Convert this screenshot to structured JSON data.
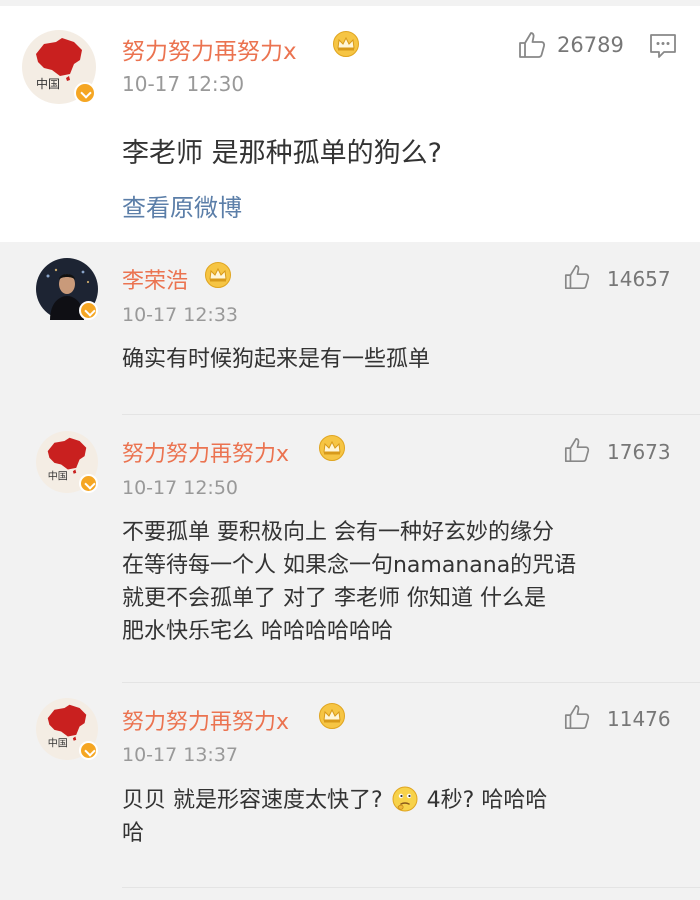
{
  "main_post": {
    "username": "努力努力再努力x",
    "time": "10-17 12:30",
    "likes": "26789",
    "text": "李老师 是那种孤单的狗么?",
    "view_original": "查看原微博"
  },
  "replies": [
    {
      "username": "李荣浩",
      "time": "10-17 12:33",
      "likes": "14657",
      "text": "确实有时候狗起来是有一些孤单"
    },
    {
      "username": "努力努力再努力x",
      "time": "10-17 12:50",
      "likes": "17673",
      "text_lines": [
        "不要孤单 要积极向上 会有一种好玄妙的缘分",
        "在等待每一个人 如果念一句namanana的咒语",
        "就更不会孤单了 对了 李老师 你知道 什么是",
        "肥水快乐宅么 哈哈哈哈哈哈"
      ]
    },
    {
      "username": "努力努力再努力x",
      "time": "10-17 13:37",
      "likes": "11476",
      "text_part1": "贝贝 就是形容速度太快了?",
      "text_part2": "4秒? 哈哈哈",
      "text_line2": "哈"
    }
  ],
  "avatar_text": {
    "china": "中国"
  },
  "colors": {
    "username": "#eb7350",
    "link": "#5b7ea8",
    "badge": "#f5a623"
  },
  "icons": [
    "thumbs-up-icon",
    "comment-icon",
    "crown-icon",
    "verified-badge-icon",
    "thinking-emoji-icon"
  ]
}
